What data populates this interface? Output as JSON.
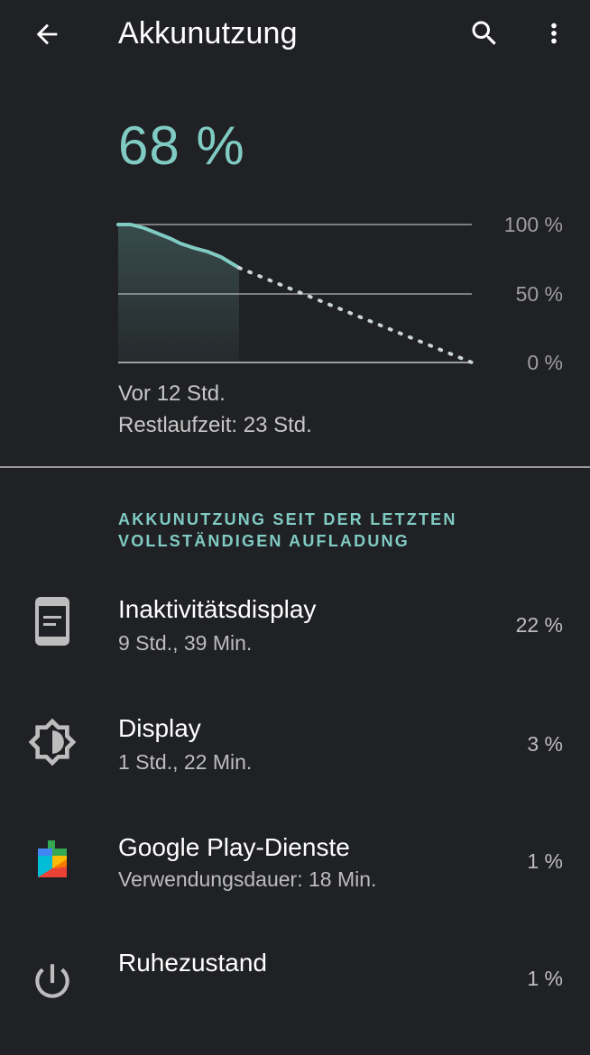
{
  "app_bar": {
    "title": "Akkunutzung",
    "back_icon": "arrow-back-icon",
    "search_icon": "search-icon",
    "more_icon": "more-vert-icon"
  },
  "battery": {
    "level_text": "68 %",
    "level_fraction": 0.68,
    "graph": {
      "y_labels": [
        "100 %",
        "50 %",
        "0 %"
      ],
      "since_text": "Vor 12 Std.",
      "remaining_text": "Restlaufzeit: 23 Std."
    }
  },
  "section": {
    "header": "AKKUNUTZUNG SEIT DER LETZTEN VOLLSTÄNDIGEN AUFLADUNG"
  },
  "usage_items": [
    {
      "icon": "ambient-display-icon",
      "title": "Inaktivitätsdisplay",
      "subtitle": "9 Std., 39 Min.",
      "value": "22 %"
    },
    {
      "icon": "brightness-icon",
      "title": "Display",
      "subtitle": "1 Std., 22 Min.",
      "value": "3 %"
    },
    {
      "icon": "google-play-services-icon",
      "title": "Google Play-Dienste",
      "subtitle": "Verwendungsdauer: 18 Min.",
      "value": "1 %"
    },
    {
      "icon": "power-icon",
      "title": "Ruhezustand",
      "subtitle": "",
      "value": "1 %"
    }
  ],
  "colors": {
    "accent": "#80cbc4",
    "background": "#202124"
  }
}
